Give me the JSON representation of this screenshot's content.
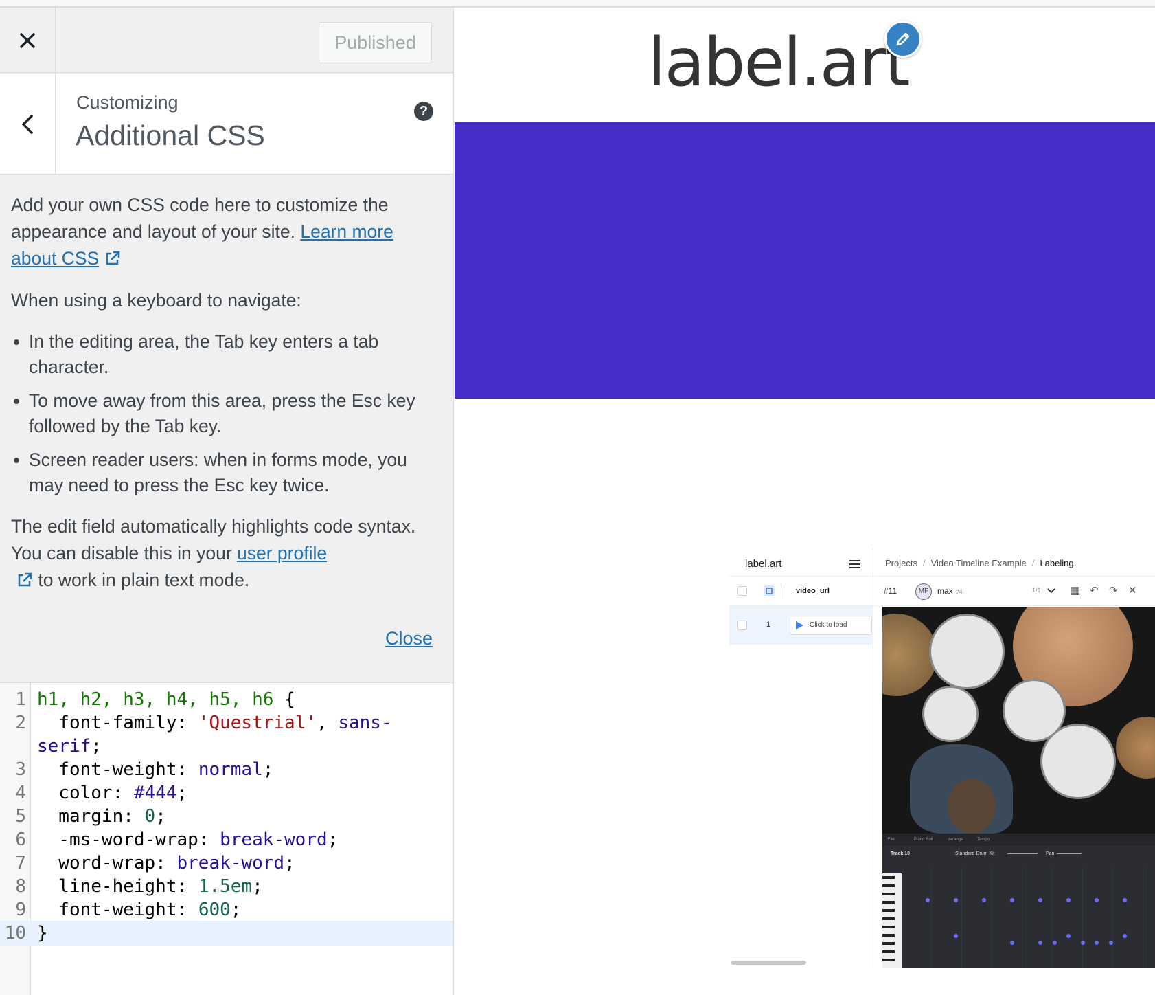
{
  "header": {
    "published_label": "Published"
  },
  "section": {
    "subtitle": "Customizing",
    "title": "Additional CSS",
    "help": "?"
  },
  "description": {
    "p1_text": "Add your own CSS code here to customize the appearance and layout of your site. ",
    "p1_link": "Learn more about CSS",
    "p2": "When using a keyboard to navigate:",
    "bullets": [
      "In the editing area, the Tab key enters a tab character.",
      "To move away from this area, press the Esc key followed by the Tab key.",
      "Screen reader users: when in forms mode, you may need to press the Esc key twice."
    ],
    "p3_text": "The edit field automatically highlights code syntax. You can disable this in your ",
    "p3_link": "user profile",
    "p3_after": " to work in plain text mode.",
    "close_label": "Close"
  },
  "editor": {
    "lines": [
      {
        "n": "1",
        "sel": "h1, h2, h3, h4, h5, h6",
        "brace": " {"
      },
      {
        "n": "2",
        "prop": "  font-family: ",
        "str": "'Questrial'",
        "mid": ", ",
        "val": "sans-"
      },
      {
        "cont": "serif",
        "tail": ";"
      },
      {
        "n": "3",
        "prop": "  font-weight: ",
        "val": "normal",
        "tail": ";"
      },
      {
        "n": "4",
        "prop": "  color: ",
        "val": "#444",
        "tail": ";"
      },
      {
        "n": "5",
        "prop": "  margin: ",
        "num": "0",
        "tail": ";"
      },
      {
        "n": "6",
        "prop": "  -ms-word-wrap: ",
        "val": "break-word",
        "tail": ";"
      },
      {
        "n": "7",
        "prop": "  word-wrap: ",
        "val": "break-word",
        "tail": ";"
      },
      {
        "n": "8",
        "prop": "  line-height: ",
        "num": "1.5em",
        "tail": ";"
      },
      {
        "n": "9",
        "prop": "  font-weight: ",
        "num": "600",
        "tail": ";"
      },
      {
        "n": "10",
        "brace": "}"
      }
    ]
  },
  "preview": {
    "logo": "label.art",
    "banner_color": "#452dc9",
    "app": {
      "logo": "label.art",
      "column_header": "video_url",
      "row_number": "1",
      "row_button": "Click to load",
      "breadcrumb": [
        "Projects",
        "Video Timeline Example",
        "Labeling"
      ],
      "task_id": "#11",
      "avatar_initials": "MF",
      "user": "max",
      "user_id": "#4",
      "pager": "1/1",
      "daw_tabs": [
        "File",
        "Piano Roll",
        "Arrange",
        "Tempo"
      ],
      "track_name": "Track 10",
      "instrument": "Standard Drum Kit",
      "pan_label": "Pan"
    }
  }
}
